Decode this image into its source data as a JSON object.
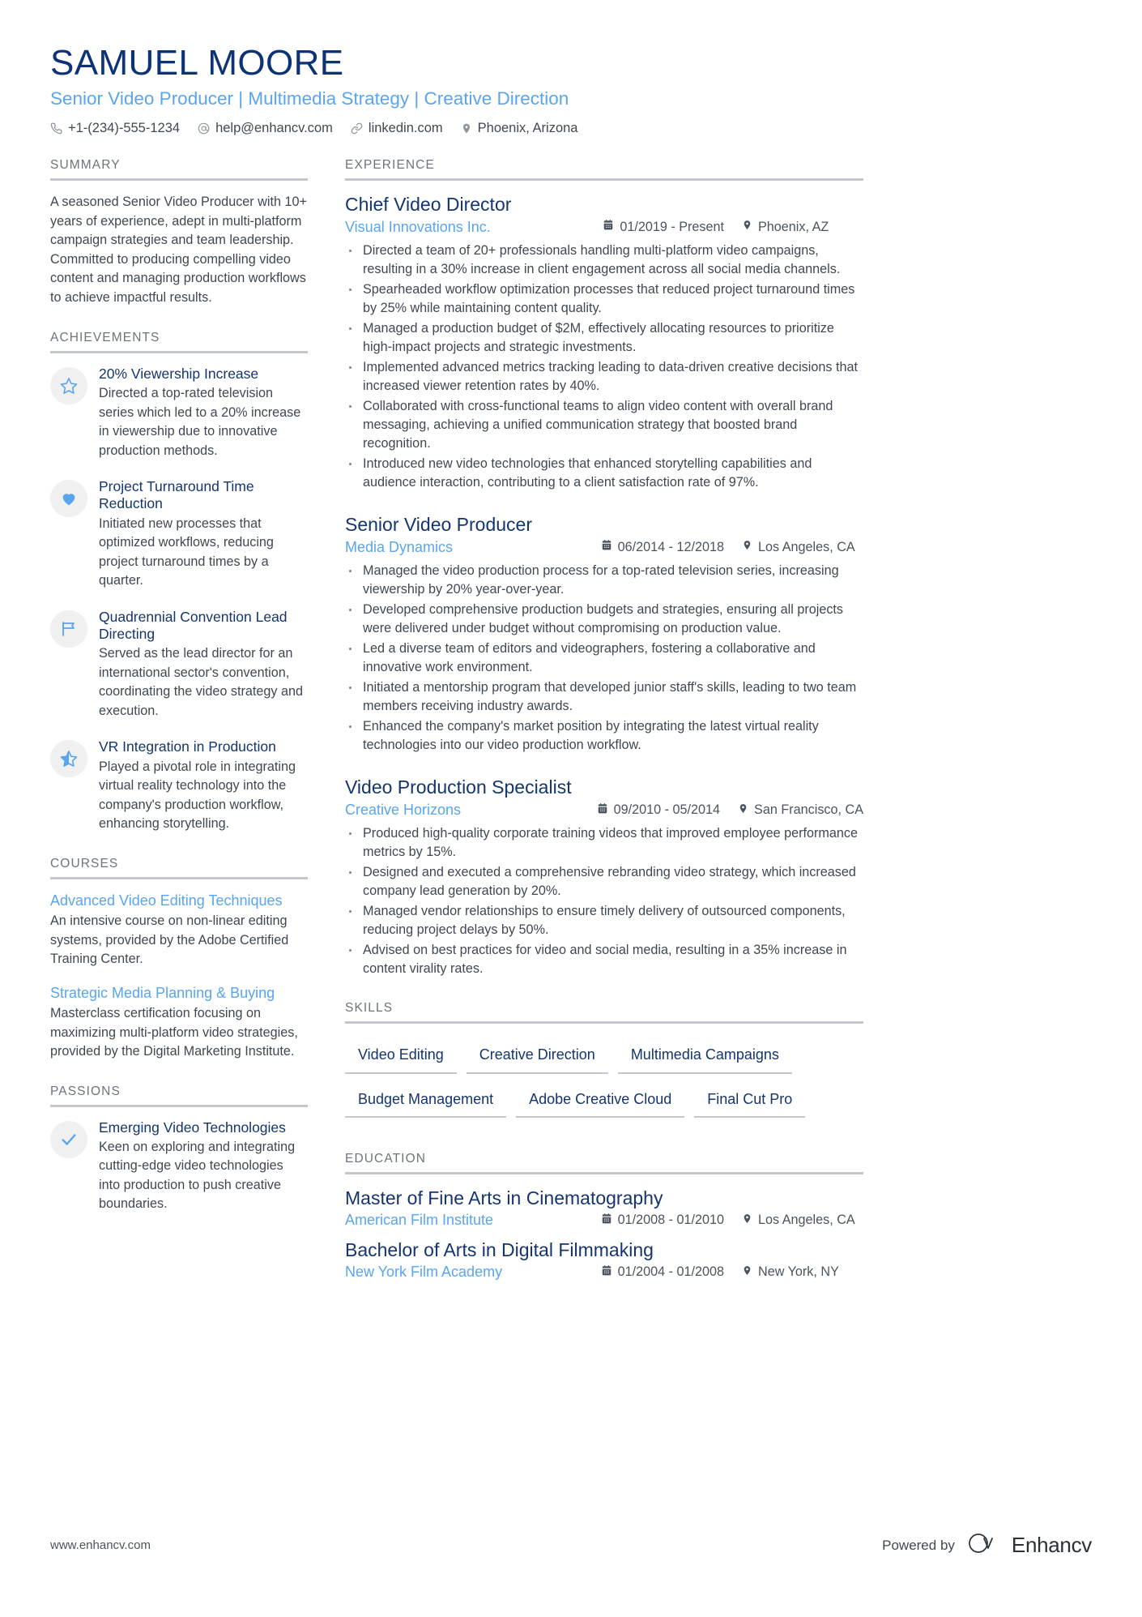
{
  "header": {
    "name": "SAMUEL MOORE",
    "title": "Senior Video Producer | Multimedia Strategy | Creative Direction",
    "contacts": [
      {
        "icon": "phone-icon",
        "text": "+1-(234)-555-1234"
      },
      {
        "icon": "email-icon",
        "text": "help@enhancv.com"
      },
      {
        "icon": "link-icon",
        "text": "linkedin.com"
      },
      {
        "icon": "location-pin-icon",
        "text": "Phoenix, Arizona"
      }
    ]
  },
  "colors": {
    "name_navy": "#0e3277",
    "accent_blue": "#59a5ef",
    "heading_navy": "#14356f",
    "body_gray": "#3f4852",
    "rule_gray": "#c3c7cc"
  },
  "summary": {
    "heading": "SUMMARY",
    "text": "A seasoned Senior Video Producer with 10+ years of experience, adept in multi-platform campaign strategies and team leadership. Committed to producing compelling video content and managing production workflows to achieve impactful results."
  },
  "achievements": {
    "heading": "ACHIEVEMENTS",
    "items": [
      {
        "icon": "star-outline-icon",
        "title": "20% Viewership Increase",
        "desc": "Directed a top-rated television series which led to a 20% increase in viewership due to innovative production methods."
      },
      {
        "icon": "heart-icon",
        "title": "Project Turnaround Time Reduction",
        "desc": "Initiated new processes that optimized workflows, reducing project turnaround times by a quarter."
      },
      {
        "icon": "flag-icon",
        "title": "Quadrennial Convention Lead Directing",
        "desc": "Served as the lead director for an international sector's convention, coordinating the video strategy and execution."
      },
      {
        "icon": "star-half-icon",
        "title": "VR Integration in Production",
        "desc": "Played a pivotal role in integrating virtual reality technology into the company's production workflow, enhancing storytelling."
      }
    ]
  },
  "courses": {
    "heading": "COURSES",
    "items": [
      {
        "title": "Advanced Video Editing Techniques",
        "desc": "An intensive course on non-linear editing systems, provided by the Adobe Certified Training Center."
      },
      {
        "title": "Strategic Media Planning & Buying",
        "desc": "Masterclass certification focusing on maximizing multi-platform video strategies, provided by the Digital Marketing Institute."
      }
    ]
  },
  "passions": {
    "heading": "PASSIONS",
    "items": [
      {
        "icon": "check-icon",
        "title": "Emerging Video Technologies",
        "desc": "Keen on exploring and integrating cutting-edge video technologies into production to push creative boundaries."
      }
    ]
  },
  "experience": {
    "heading": "EXPERIENCE",
    "items": [
      {
        "role": "Chief Video Director",
        "company": "Visual Innovations Inc.",
        "dates": "01/2019 - Present",
        "location": "Phoenix, AZ",
        "bullets": [
          "Directed a team of 20+ professionals handling multi-platform video campaigns, resulting in a 30% increase in client engagement across all social media channels.",
          "Spearheaded workflow optimization processes that reduced project turnaround times by 25% while maintaining content quality.",
          "Managed a production budget of $2M, effectively allocating resources to prioritize high-impact projects and strategic investments.",
          "Implemented advanced metrics tracking leading to data-driven creative decisions that increased viewer retention rates by 40%.",
          "Collaborated with cross-functional teams to align video content with overall brand messaging, achieving a unified communication strategy that boosted brand recognition.",
          "Introduced new video technologies that enhanced storytelling capabilities and audience interaction, contributing to a client satisfaction rate of 97%."
        ]
      },
      {
        "role": "Senior Video Producer",
        "company": "Media Dynamics",
        "dates": "06/2014 - 12/2018",
        "location": "Los Angeles, CA",
        "bullets": [
          "Managed the video production process for a top-rated television series, increasing viewership by 20% year-over-year.",
          "Developed comprehensive production budgets and strategies, ensuring all projects were delivered under budget without compromising on production value.",
          "Led a diverse team of editors and videographers, fostering a collaborative and innovative work environment.",
          "Initiated a mentorship program that developed junior staff's skills, leading to two team members receiving industry awards.",
          "Enhanced the company's market position by integrating the latest virtual reality technologies into our video production workflow."
        ]
      },
      {
        "role": "Video Production Specialist",
        "company": "Creative Horizons",
        "dates": "09/2010 - 05/2014",
        "location": "San Francisco, CA",
        "bullets": [
          "Produced high-quality corporate training videos that improved employee performance metrics by 15%.",
          "Designed and executed a comprehensive rebranding video strategy, which increased company lead generation by 20%.",
          "Managed vendor relationships to ensure timely delivery of outsourced components, reducing project delays by 50%.",
          "Advised on best practices for video and social media, resulting in a 35% increase in content virality rates."
        ]
      }
    ]
  },
  "skills": {
    "heading": "SKILLS",
    "items": [
      "Video Editing",
      "Creative Direction",
      "Multimedia Campaigns",
      "Budget Management",
      "Adobe Creative Cloud",
      "Final Cut Pro"
    ]
  },
  "education": {
    "heading": "EDUCATION",
    "items": [
      {
        "degree": "Master of Fine Arts in Cinematography",
        "school": "American Film Institute",
        "dates": "01/2008 - 01/2010",
        "location": "Los Angeles, CA"
      },
      {
        "degree": "Bachelor of Arts in Digital Filmmaking",
        "school": "New York Film Academy",
        "dates": "01/2004 - 01/2008",
        "location": "New York, NY"
      }
    ]
  },
  "footer": {
    "url": "www.enhancv.com",
    "powered_by": "Powered by",
    "brand": "Enhancv"
  }
}
